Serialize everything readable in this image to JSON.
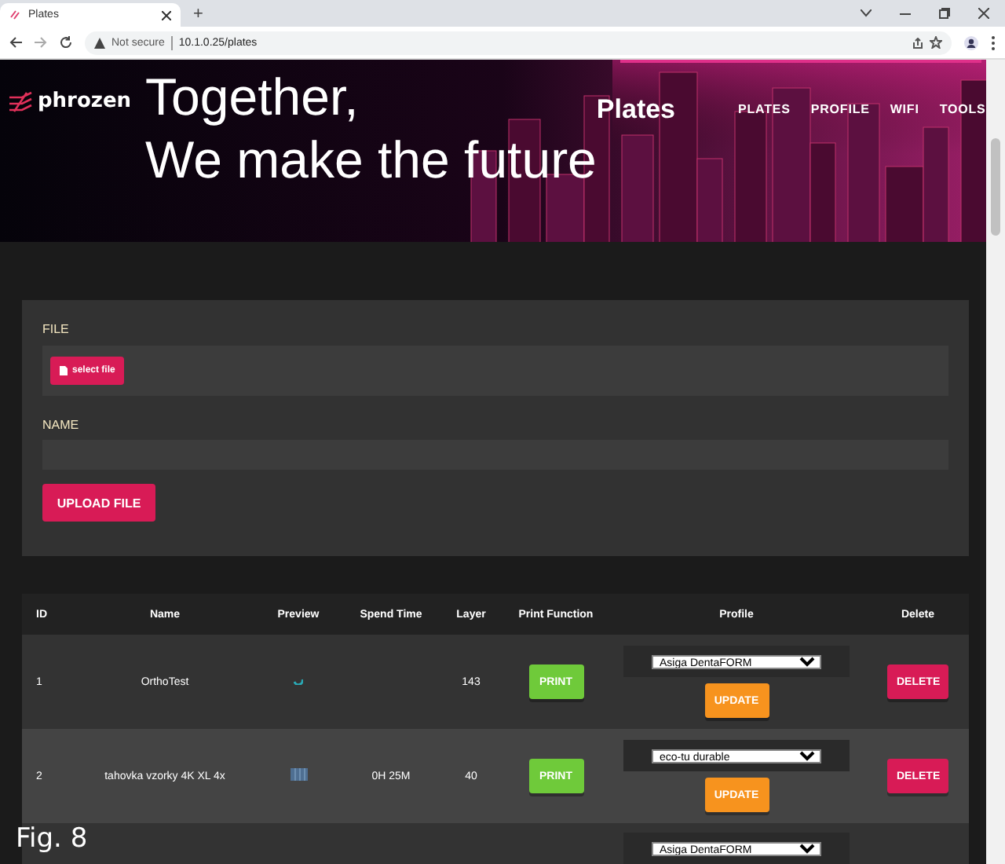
{
  "browser": {
    "tab_title": "Plates",
    "new_tab": "+",
    "security": "Not secure",
    "url": "10.1.0.25/plates"
  },
  "header": {
    "logo": "phrozen",
    "tagline": [
      "Together,",
      "We make the future"
    ],
    "page_title": "Plates",
    "nav": [
      "PLATES",
      "PROFILE",
      "WIFI",
      "TOOLS"
    ],
    "banner": {
      "kind": "picture"
    }
  },
  "upload_form": {
    "file_label": "FILE",
    "select_button": "select file",
    "name_label": "NAME",
    "upload_button": "UPLOAD FILE"
  },
  "table": {
    "columns": [
      "ID",
      "Name",
      "Preview",
      "Spend Time",
      "Layer",
      "Print Function",
      "Profile",
      "Delete"
    ],
    "rows": [
      {
        "id": "1",
        "name": "OrthoTest",
        "preview": {
          "kind": "arc"
        },
        "layer": "143",
        "print": "PRINT",
        "profile": "Asiga DentaFORM",
        "update": "UPDATE",
        "delete": "DELETE"
      },
      {
        "id": "2",
        "name": "tahovka vzorky 4K XL 4x",
        "preview": {
          "kind": "grid"
        },
        "spend_time": "0H 25M",
        "layer": "40",
        "print": "PRINT",
        "profile": "eco-tu durable",
        "update": "UPDATE",
        "delete": "DELETE"
      },
      {
        "profile": "Asiga DentaFORM"
      }
    ]
  },
  "figure_label": "Fig. 8"
}
